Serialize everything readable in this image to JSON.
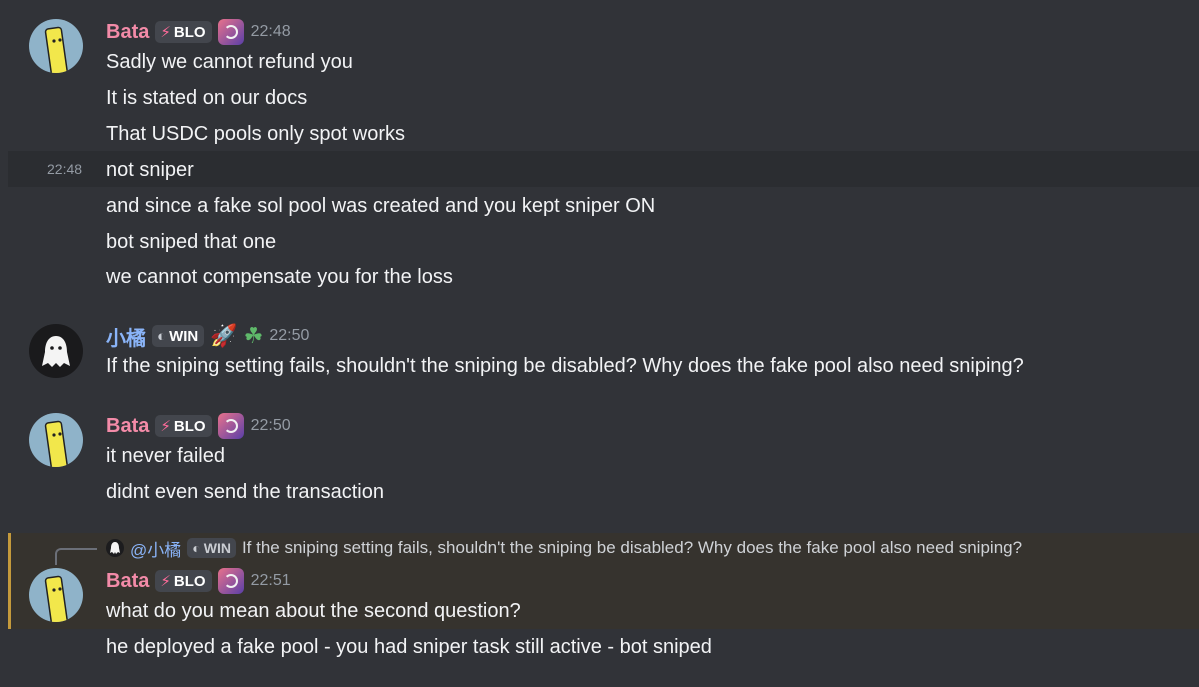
{
  "messages": [
    {
      "author": "Bata",
      "tag": {
        "icon": "⚡",
        "label": "BLO"
      },
      "time": "22:48",
      "lines": [
        "Sadly we cannot refund you",
        "It is stated on our docs",
        "That USDC pools only spot works"
      ],
      "followups": [
        {
          "time": "22:48",
          "text": "not sniper"
        },
        {
          "time": "",
          "text": "and since a fake sol pool was created and you kept sniper ON"
        },
        {
          "time": "",
          "text": "bot sniped that one"
        },
        {
          "time": "",
          "text": "we cannot compensate you for the loss"
        }
      ]
    },
    {
      "author": "小橘",
      "tag": {
        "icon": "◐",
        "label": "WIN"
      },
      "emojis": [
        "🚀",
        "☘"
      ],
      "time": "22:50",
      "lines": [
        "If the sniping setting fails, shouldn't the sniping be disabled? Why does the fake pool also need sniping?"
      ]
    },
    {
      "author": "Bata",
      "tag": {
        "icon": "⚡",
        "label": "BLO"
      },
      "time": "22:50",
      "lines": [
        "it never failed",
        "didnt even send the transaction"
      ]
    },
    {
      "reply": {
        "mention": "@小橘",
        "tag": {
          "icon": "◐",
          "label": "WIN"
        },
        "text": "If the sniping setting fails, shouldn't the sniping be disabled? Why does the fake pool also need sniping?"
      },
      "author": "Bata",
      "tag": {
        "icon": "⚡",
        "label": "BLO"
      },
      "time": "22:51",
      "lines": [
        "what do you mean about the second question?",
        "he deployed a fake pool - you had sniper task still active - bot sniped"
      ]
    }
  ],
  "colors": {
    "background": "#313338",
    "bata_name": "#f38ba8",
    "xiaoju_name": "#8ab4f8",
    "highlight_border": "#c49a3c"
  }
}
